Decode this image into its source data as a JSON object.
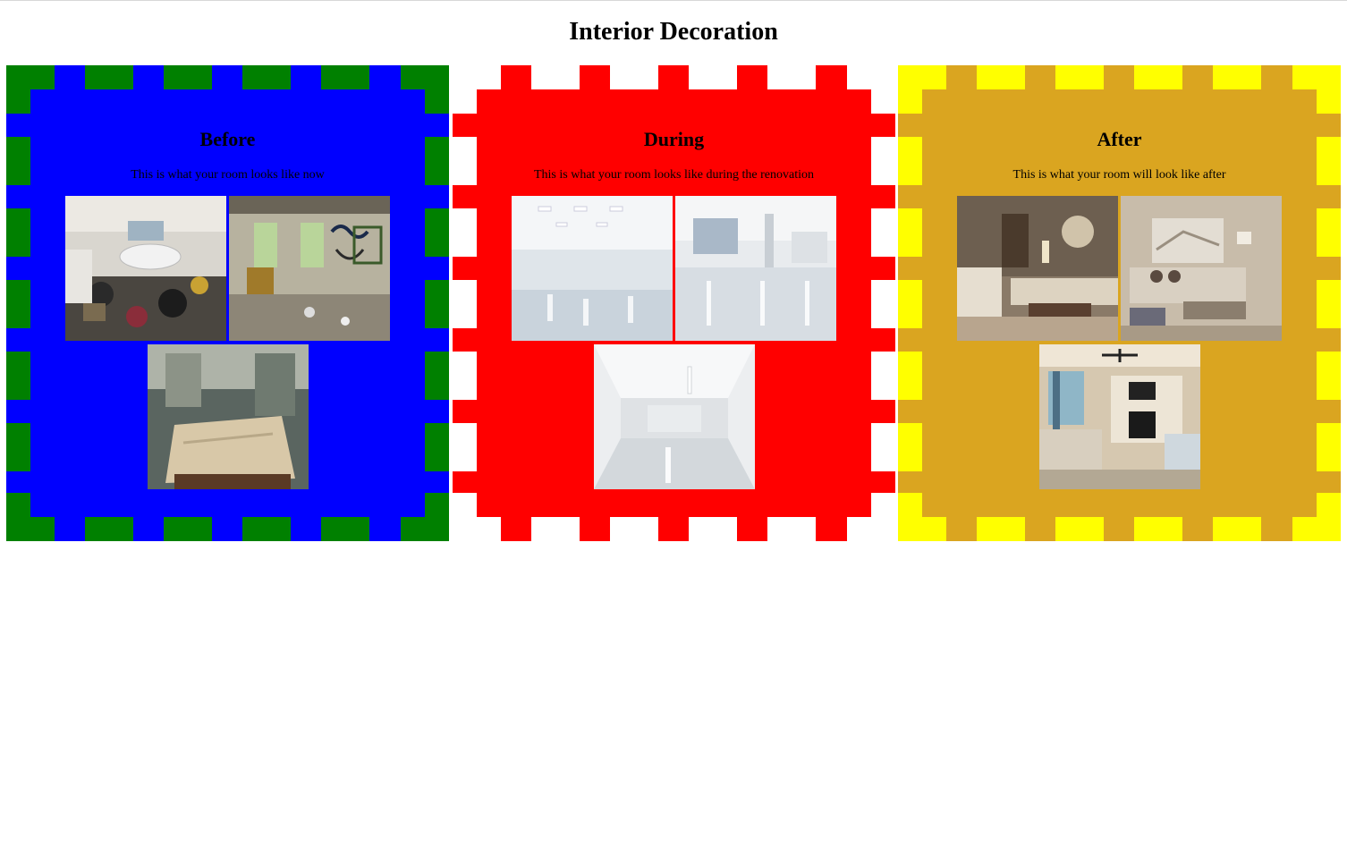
{
  "page": {
    "title": "Interior Decoration"
  },
  "panels": [
    {
      "heading": "Before",
      "description": "This is what your room looks like now",
      "colors": {
        "fill": "#0000ff",
        "pattern": "#008000",
        "gaps": "#0000ff"
      },
      "photos": [
        "Cluttered bathroom",
        "Graffiti-covered room",
        "Decayed bedroom"
      ]
    },
    {
      "heading": "During",
      "description": "This is what your room looks like during the renovation",
      "colors": {
        "fill": "#ff0000",
        "pattern": "#ff0000",
        "gaps": "#ffffff"
      },
      "photos": [
        "Empty white hall",
        "Glossy white hall",
        "Bare white room"
      ]
    },
    {
      "heading": "After",
      "description": "This is what your room will look like after",
      "colors": {
        "fill": "#daa520",
        "pattern": "#ffff00",
        "gaps": "#daa520"
      },
      "photos": [
        "Living room with chandelier",
        "Beige living room",
        "Living room with fireplace"
      ]
    }
  ]
}
